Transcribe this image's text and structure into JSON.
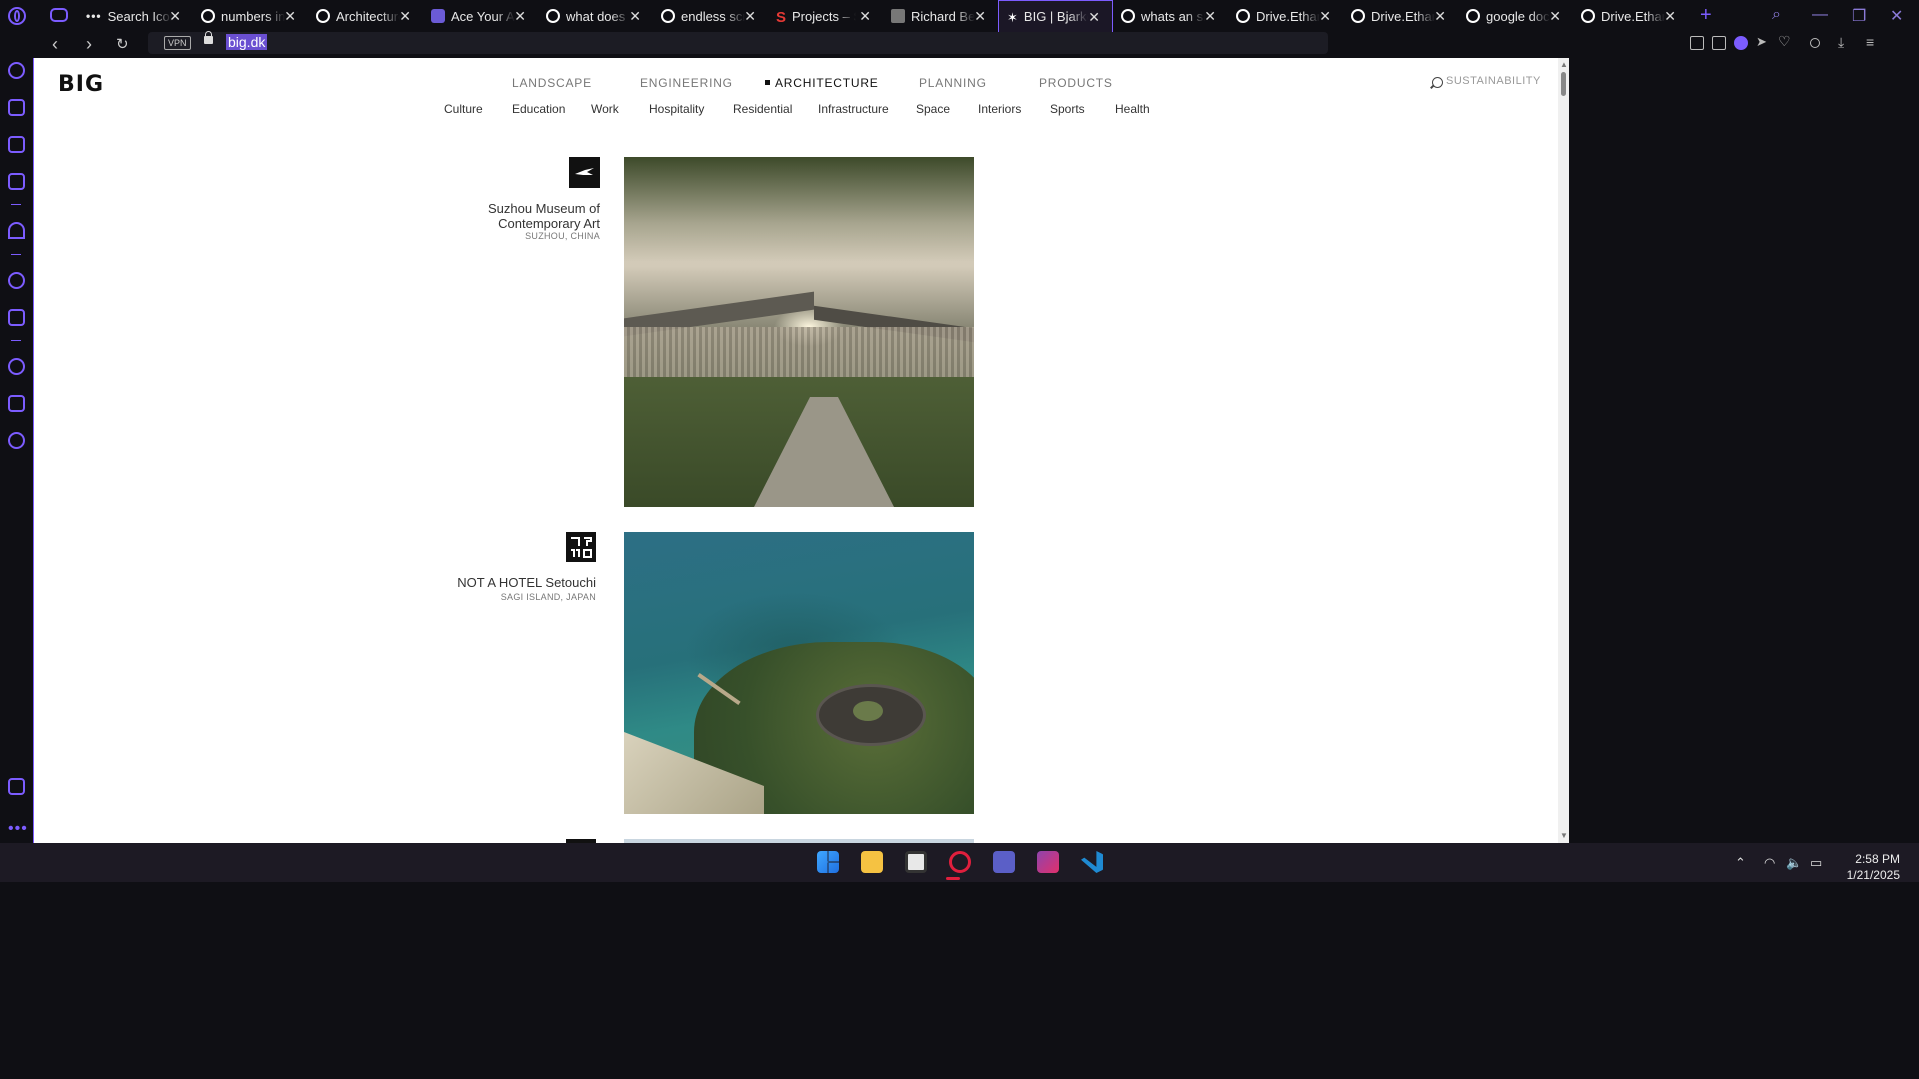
{
  "browser": {
    "tabs": [
      {
        "title": "Search Icon",
        "favicon": "dots"
      },
      {
        "title": "numbers in",
        "favicon": "google"
      },
      {
        "title": "Architecture",
        "favicon": "google"
      },
      {
        "title": "Ace Your A",
        "favicon": "purple"
      },
      {
        "title": "what does",
        "favicon": "google"
      },
      {
        "title": "endless scr",
        "favicon": "google"
      },
      {
        "title": "Projects – S",
        "favicon": "s-logo"
      },
      {
        "title": "Richard Bel",
        "favicon": "gray"
      },
      {
        "title": "BIG | Bjarke",
        "favicon": "big",
        "active": true
      },
      {
        "title": "whats an sr",
        "favicon": "google"
      },
      {
        "title": "Drive.Ethan",
        "favicon": "globe"
      },
      {
        "title": "Drive.Ethan",
        "favicon": "globe"
      },
      {
        "title": "google doc",
        "favicon": "google"
      },
      {
        "title": "Drive.Ethan",
        "favicon": "globe"
      }
    ],
    "vpn_label": "VPN",
    "url": "big.dk",
    "accent": "#7c5cff"
  },
  "site": {
    "logo": "BIG",
    "main_nav": [
      "LANDSCAPE",
      "ENGINEERING",
      "ARCHITECTURE",
      "PLANNING",
      "PRODUCTS"
    ],
    "active_nav": "ARCHITECTURE",
    "sustainability": "SUSTAINABILITY",
    "sub_nav": [
      "Culture",
      "Education",
      "Work",
      "Hospitality",
      "Residential",
      "Infrastructure",
      "Space",
      "Interiors",
      "Sports",
      "Health"
    ],
    "projects": [
      {
        "title_line1": "Suzhou Museum of",
        "title_line2": "Contemporary Art",
        "location": "SUZHOU, CHINA",
        "icon": "bird-icon"
      },
      {
        "title_line1": "NOT A HOTEL Setouchi",
        "title_line2": "",
        "location": "SAGI ISLAND, JAPAN",
        "icon": "glyph-icon"
      }
    ]
  },
  "taskbar": {
    "time": "2:58 PM",
    "date": "1/21/2025"
  }
}
